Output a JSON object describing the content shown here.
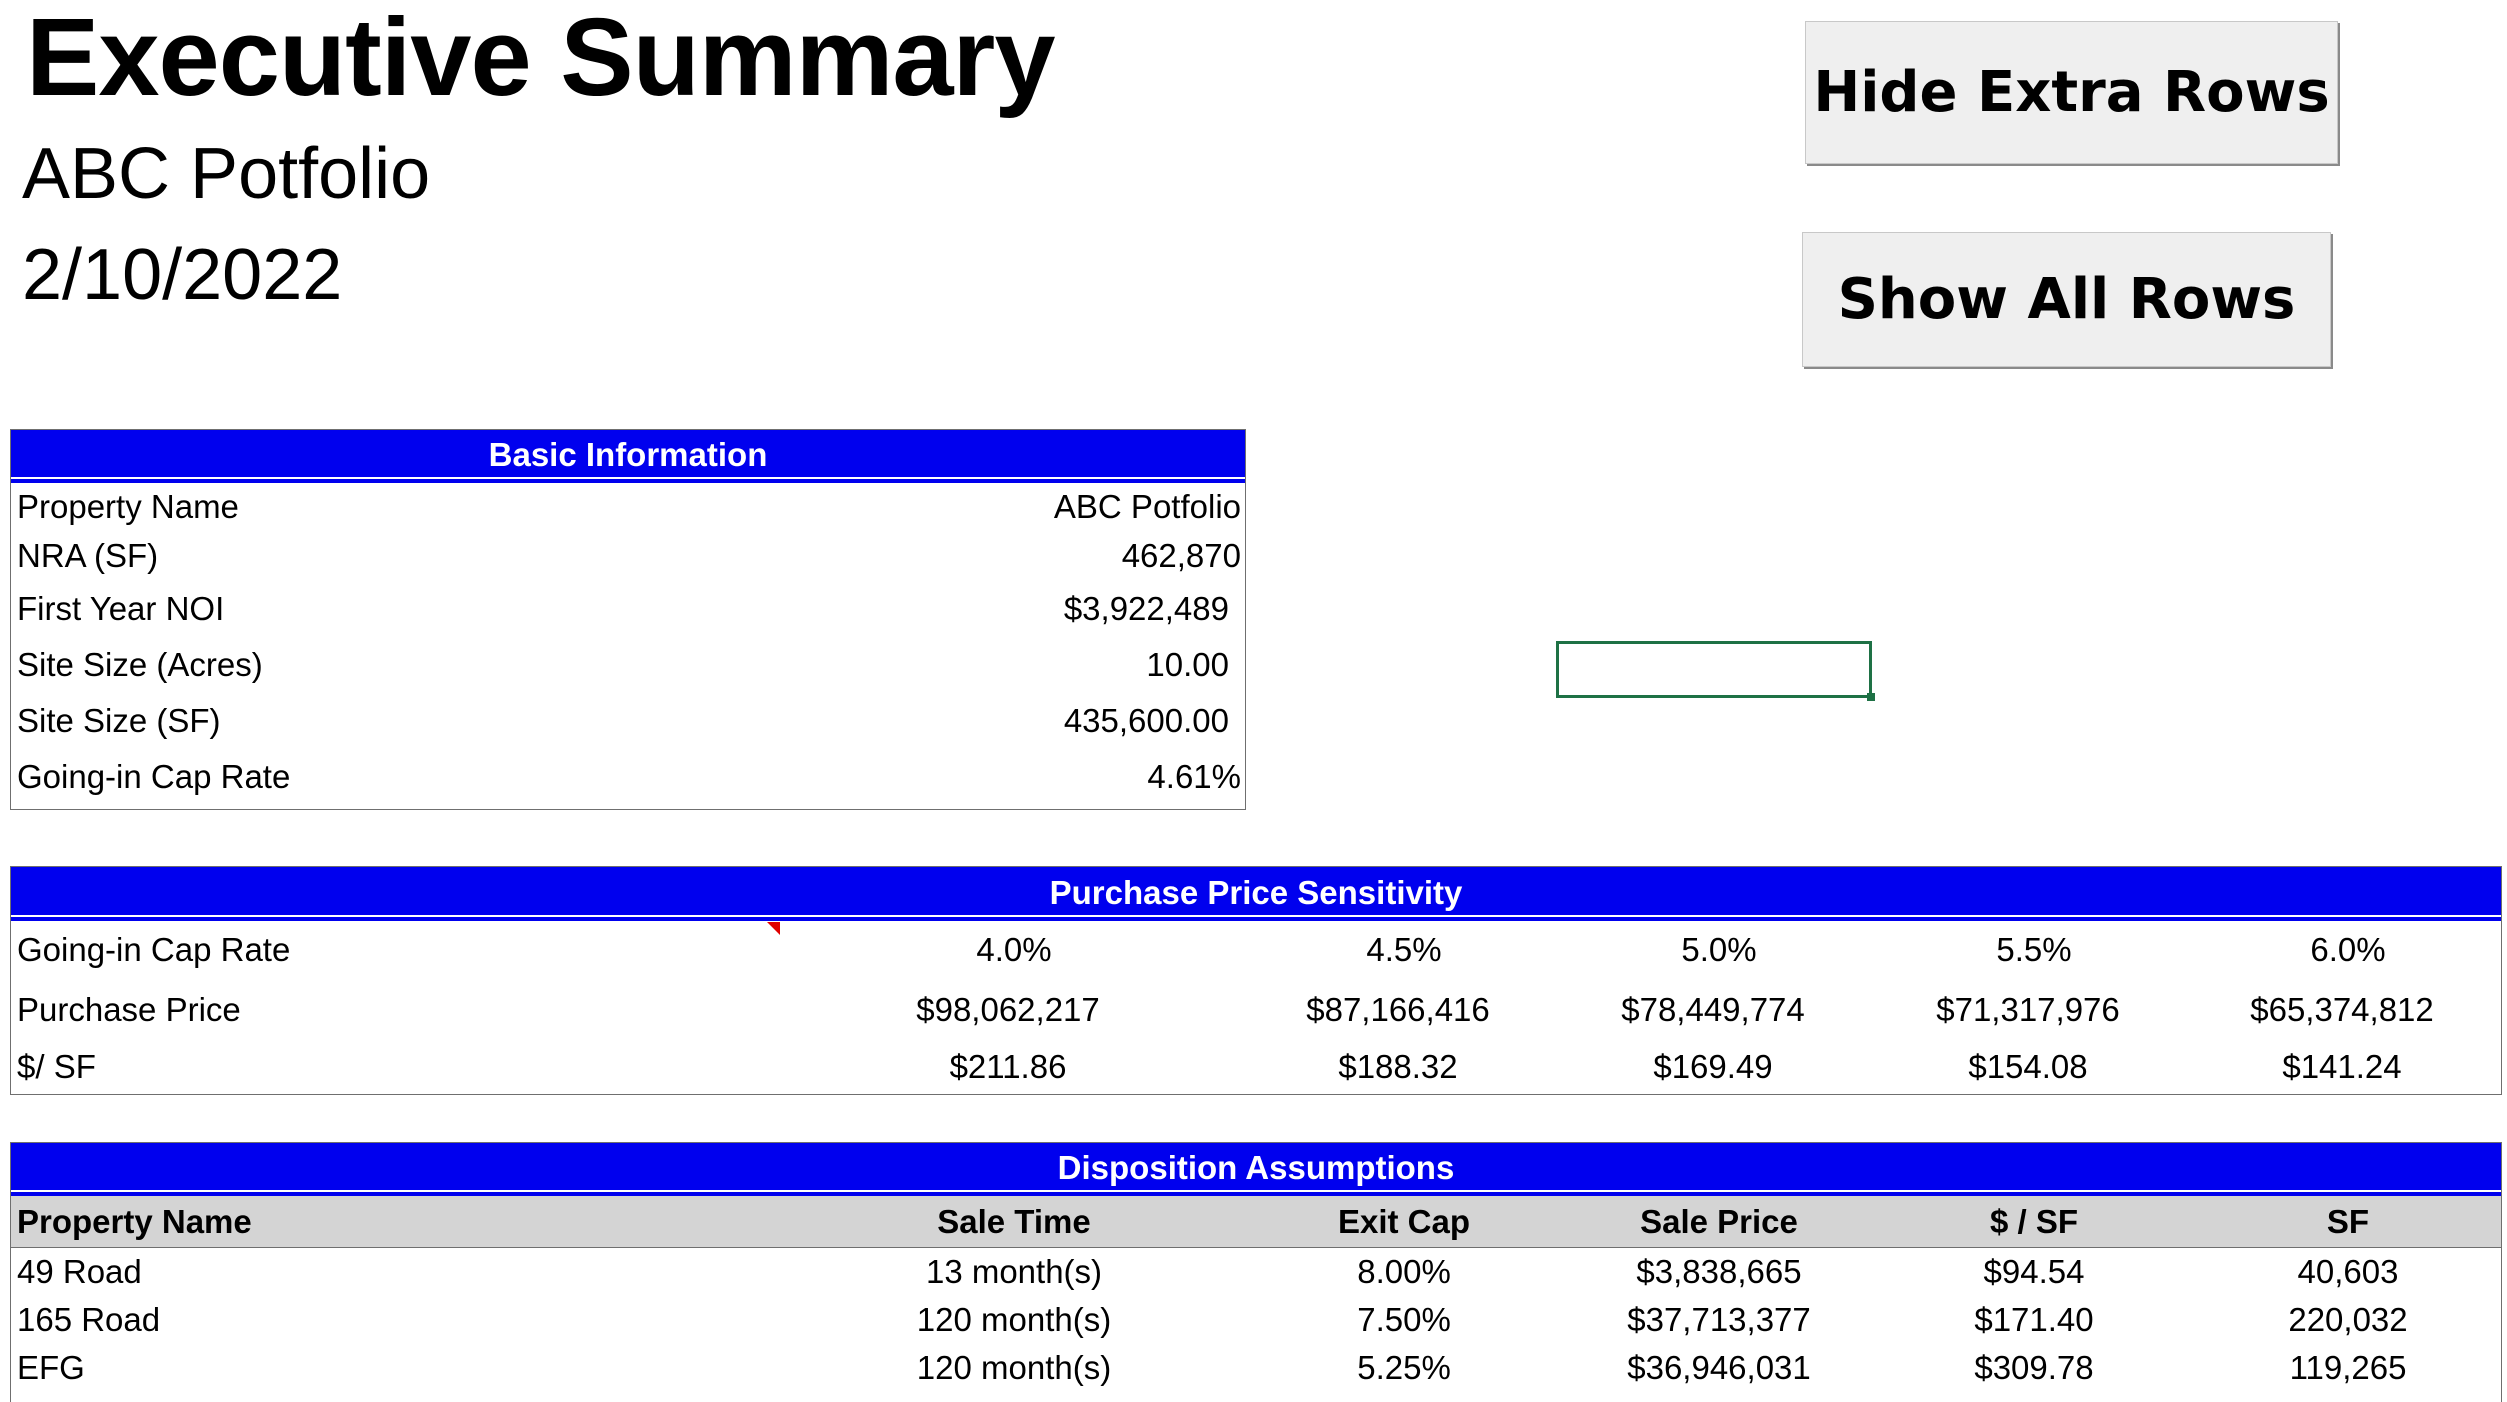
{
  "header": {
    "title": "Executive Summary",
    "subtitle": "ABC Potfolio",
    "date": "2/10/2022"
  },
  "buttons": {
    "hide_rows": "Hide Extra Rows",
    "show_rows": "Show All Rows"
  },
  "basic_info": {
    "title": "Basic Information",
    "rows": [
      {
        "label": "Property Name",
        "value": "ABC Potfolio"
      },
      {
        "label": "NRA (SF)",
        "value": "462,870"
      },
      {
        "label": "First Year NOI",
        "value": "$3,922,489"
      },
      {
        "label": "Site Size (Acres)",
        "value": "10.00"
      },
      {
        "label": "Site Size (SF)",
        "value": "435,600.00"
      },
      {
        "label": "Going-in Cap Rate",
        "value": "4.61%"
      }
    ]
  },
  "price_sensitivity": {
    "title": "Purchase Price Sensitivity",
    "rows": [
      {
        "label": "Going-in Cap Rate",
        "values": [
          "4.0%",
          "4.5%",
          "5.0%",
          "5.5%",
          "6.0%"
        ]
      },
      {
        "label": "Purchase Price",
        "values": [
          "$98,062,217",
          "$87,166,416",
          "$78,449,774",
          "$71,317,976",
          "$65,374,812"
        ]
      },
      {
        "label": "$/ SF",
        "values": [
          "$211.86",
          "$188.32",
          "$169.49",
          "$154.08",
          "$141.24"
        ]
      }
    ]
  },
  "disposition": {
    "title": "Disposition Assumptions",
    "columns": [
      "Property Name",
      "Sale Time",
      "Exit Cap",
      "Sale Price",
      "$ / SF",
      "SF"
    ],
    "rows": [
      [
        "49 Road",
        "13 month(s)",
        "8.00%",
        "$3,838,665",
        "$94.54",
        "40,603"
      ],
      [
        "165 Road",
        "120 month(s)",
        "7.50%",
        "$37,713,377",
        "$171.40",
        "220,032"
      ],
      [
        "EFG",
        "120 month(s)",
        "5.25%",
        "$36,946,031",
        "$309.78",
        "119,265"
      ]
    ]
  }
}
